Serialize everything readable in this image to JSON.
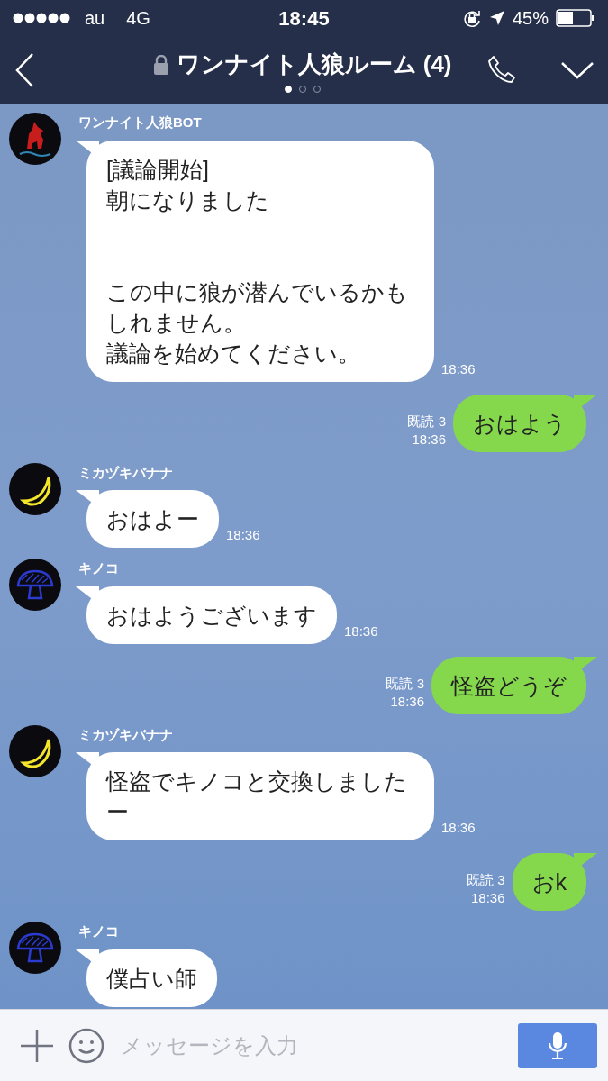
{
  "status_bar": {
    "carrier": "au",
    "network": "4G",
    "time": "18:45",
    "battery": "45%"
  },
  "header": {
    "title": "ワンナイト人狼ルーム (4)",
    "locked": true,
    "pages": [
      {
        "selected": true
      },
      {
        "selected": false
      },
      {
        "selected": false
      }
    ]
  },
  "messages": [
    {
      "kind": "incoming",
      "sender": "ワンナイト人狼BOT",
      "avatar": {
        "kind": "wolf"
      },
      "paragraphs": [
        [
          "[議論開始]",
          "朝になりました"
        ],
        [
          "この中に狼が潜んでいるかもしれません。",
          "議論を始めてください。"
        ]
      ],
      "time": "18:36"
    },
    {
      "kind": "outgoing",
      "read": "既読 3",
      "paragraphs": [
        [
          "おはよう"
        ]
      ],
      "time": "18:36"
    },
    {
      "kind": "incoming",
      "sender": "ミカヅキバナナ",
      "avatar": {
        "kind": "banana"
      },
      "paragraphs": [
        [
          "おはよー"
        ]
      ],
      "time": "18:36"
    },
    {
      "kind": "incoming",
      "sender": "キノコ",
      "avatar": {
        "kind": "mushroom"
      },
      "paragraphs": [
        [
          "おはようございます"
        ]
      ],
      "time": "18:36"
    },
    {
      "kind": "outgoing",
      "read": "既読 3",
      "paragraphs": [
        [
          "怪盗どうぞ"
        ]
      ],
      "time": "18:36"
    },
    {
      "kind": "incoming",
      "sender": "ミカヅキバナナ",
      "avatar": {
        "kind": "banana"
      },
      "paragraphs": [
        [
          "怪盗でキノコと交換しましたー"
        ]
      ],
      "time": "18:36"
    },
    {
      "kind": "outgoing",
      "read": "既読 3",
      "paragraphs": [
        [
          "おk"
        ]
      ],
      "time": "18:36"
    },
    {
      "kind": "incoming",
      "sender": "キノコ",
      "avatar": {
        "kind": "mushroom"
      },
      "paragraphs": [
        [
          "僕占い師"
        ]
      ]
    }
  ],
  "input": {
    "placeholder": "メッセージを入力"
  }
}
